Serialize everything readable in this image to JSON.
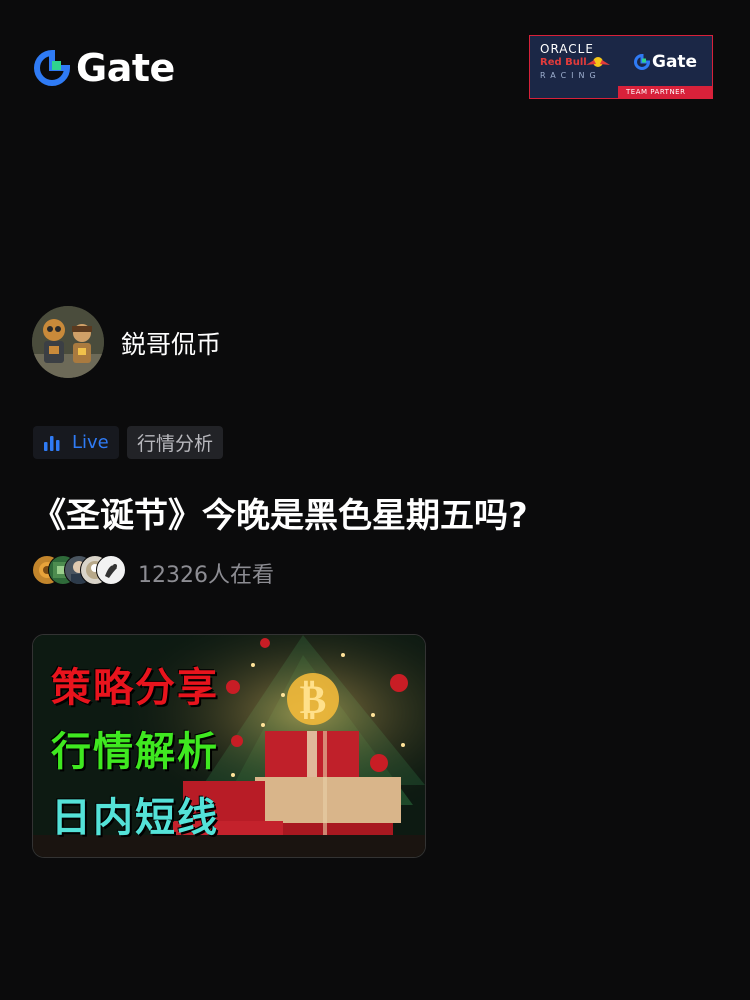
{
  "header": {
    "logo_text": "Gate",
    "partner": {
      "oracle": "ORACLE",
      "redbull": "Red Bull",
      "racing": "RACING",
      "gate_text": "Gate",
      "badge": "TEAM PARTNER"
    }
  },
  "author": {
    "name": "鋭哥侃币",
    "avatar_icon": "robot-avatar"
  },
  "tags": {
    "live_label": "Live",
    "category_label": "行情分析"
  },
  "title": "《圣诞节》今晚是黑色星期五吗?",
  "viewers": {
    "count_text": "12326人在看"
  },
  "thumbnail": {
    "lines": [
      "策略分享",
      "行情解析",
      "日内短线"
    ]
  },
  "colors": {
    "background": "#0b0b0c",
    "brand_blue": "#2f7bf5",
    "live_blue": "#2f7bf5",
    "partner_navy": "#1b2746",
    "partner_red": "#d8213a",
    "thumb_red": "#e8141d",
    "thumb_green": "#3fe820",
    "thumb_cyan": "#54e2d8"
  }
}
